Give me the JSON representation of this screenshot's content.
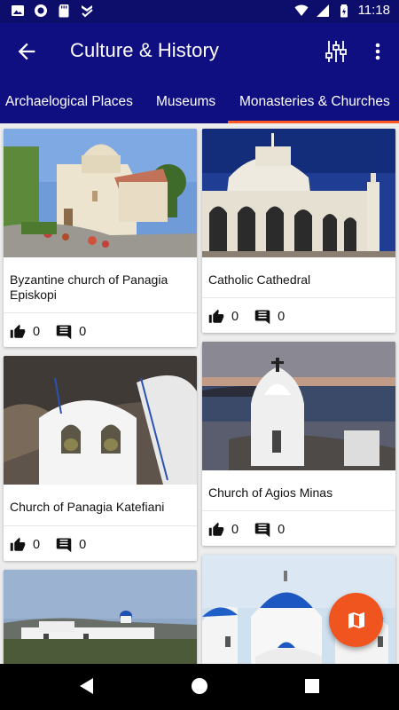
{
  "status_bar": {
    "time": "11:18",
    "left_icons": [
      "photo-icon",
      "circle-icon",
      "sd-card-icon",
      "check-icon"
    ],
    "right_icons": [
      "wifi-icon",
      "signal-icon",
      "battery-icon"
    ]
  },
  "app_bar": {
    "title": "Culture & History",
    "back_icon": "arrow-back-icon",
    "actions": [
      "filter-icon",
      "more-vert-icon"
    ]
  },
  "tabs": [
    {
      "label": "Archaelogical Places",
      "selected": false
    },
    {
      "label": "Museums",
      "selected": false
    },
    {
      "label": "Monasteries & Churches",
      "selected": true
    }
  ],
  "colors": {
    "app_bar": "#0f0f82",
    "status_bar": "#0d0d6b",
    "tab_indicator": "#ff5722",
    "fab": "#f0541f"
  },
  "cards": [
    {
      "name": "Byzantine church of Panagia Episkopi",
      "likes": "0",
      "comments": "0"
    },
    {
      "name": "Catholic Cathedral",
      "likes": "0",
      "comments": "0"
    },
    {
      "name": "Church of Panagia Katefiani",
      "likes": "0",
      "comments": "0"
    },
    {
      "name": "Church of Agios Minas",
      "likes": "0",
      "comments": "0"
    },
    {
      "name": "",
      "likes": "",
      "comments": ""
    },
    {
      "name": "",
      "likes": "",
      "comments": ""
    }
  ],
  "fab": {
    "icon": "map-icon"
  },
  "nav_bar": [
    "back-triangle-icon",
    "home-circle-icon",
    "recents-square-icon"
  ]
}
